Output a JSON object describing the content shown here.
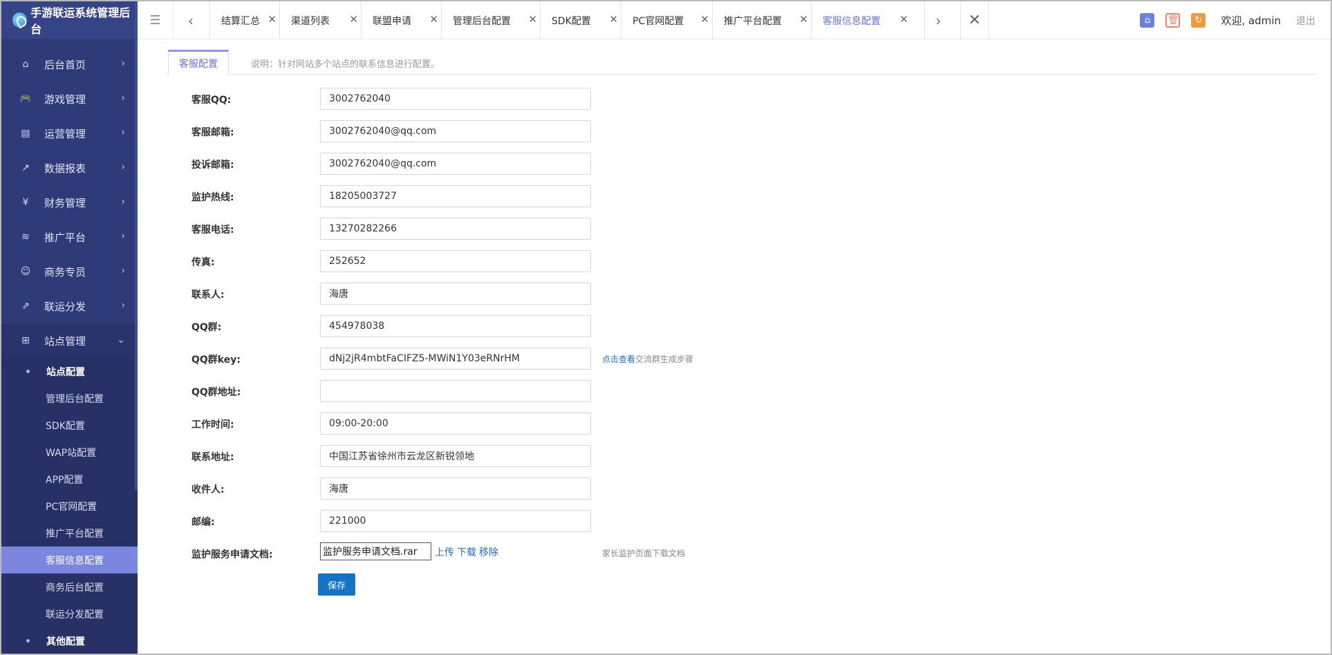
{
  "app": {
    "title": "手游联运系统管理后台"
  },
  "sidebar": {
    "items": [
      {
        "label": "后台首页",
        "icon": "home-icon"
      },
      {
        "label": "游戏管理",
        "icon": "gamepad-icon"
      },
      {
        "label": "运营管理",
        "icon": "chart-box-icon"
      },
      {
        "label": "数据报表",
        "icon": "line-chart-icon"
      },
      {
        "label": "财务管理",
        "icon": "yen-icon"
      },
      {
        "label": "推广平台",
        "icon": "layers-icon"
      },
      {
        "label": "商务专员",
        "icon": "user-icon"
      },
      {
        "label": "联运分发",
        "icon": "share-icon"
      },
      {
        "label": "站点管理",
        "icon": "sitemap-icon"
      }
    ],
    "site_group": "站点配置",
    "site_items": [
      "管理后台配置",
      "SDK配置",
      "WAP站配置",
      "APP配置",
      "PC官网配置",
      "推广平台配置",
      "客服信息配置",
      "商务后台配置",
      "联运分发配置"
    ],
    "other_group": "其他配置"
  },
  "tabs": [
    {
      "label": "结算汇总",
      "width": 101
    },
    {
      "label": "渠道列表",
      "width": 118
    },
    {
      "label": "联盟申请",
      "width": 116
    },
    {
      "label": "管理后台配置",
      "width": 143
    },
    {
      "label": "SDK配置",
      "width": 117
    },
    {
      "label": "PC官网配置",
      "width": 132
    },
    {
      "label": "推广平台配置",
      "width": 143
    },
    {
      "label": "客服信息配置",
      "width": 145
    }
  ],
  "header": {
    "welcome": "欢迎, admin",
    "logout": "退出"
  },
  "content": {
    "tab": "客服配置",
    "description": "说明：针对网站多个站点的联系信息进行配置。"
  },
  "form": {
    "fields": [
      {
        "label": "客服QQ:",
        "value": "3002762040"
      },
      {
        "label": "客服邮箱:",
        "value": "3002762040@qq.com"
      },
      {
        "label": "投诉邮箱:",
        "value": "3002762040@qq.com"
      },
      {
        "label": "监护热线:",
        "value": "18205003727"
      },
      {
        "label": "客服电话:",
        "value": "13270282266"
      },
      {
        "label": "传真:",
        "value": "252652"
      },
      {
        "label": "联系人:",
        "value": "海唐"
      },
      {
        "label": "QQ群:",
        "value": "454978038"
      },
      {
        "label": "QQ群key:",
        "value": "dNj2jR4mbtFaCIFZ5-MWiN1Y03eRNrHM"
      },
      {
        "label": "QQ群地址:",
        "value": ""
      },
      {
        "label": "工作时间:",
        "value": "09:00-20:00"
      },
      {
        "label": "联系地址:",
        "value": "中国江苏省徐州市云龙区新锐领地"
      },
      {
        "label": "收件人:",
        "value": "海唐"
      },
      {
        "label": "邮编:",
        "value": "221000"
      }
    ],
    "qqkey_link": "点击查看",
    "qqkey_hint": "交流群生成步骤",
    "doc_label": "监护服务申请文档:",
    "doc_file": "监护服务申请文档.rar",
    "doc_upload": "上传",
    "doc_download": "下载",
    "doc_remove": "移除",
    "doc_hint": "家长监护页面下载文档",
    "save": "保存"
  }
}
